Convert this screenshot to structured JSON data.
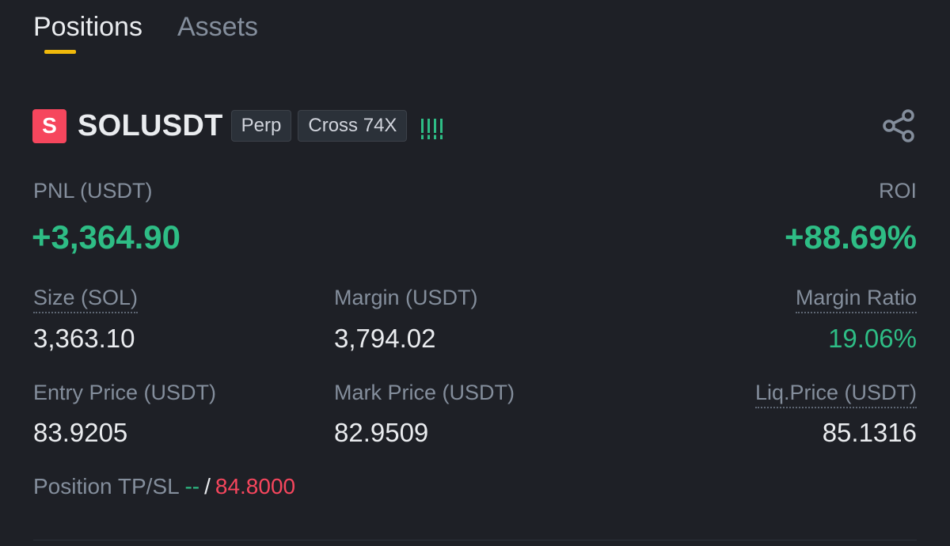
{
  "tabs": [
    "Positions",
    "Assets"
  ],
  "position": {
    "side_letter": "S",
    "symbol": "SOLUSDT",
    "type_tag": "Perp",
    "margin_tag": "Cross 74X",
    "pnl_label": "PNL (USDT)",
    "pnl_value": "+3,364.90",
    "roi_label": "ROI",
    "roi_value": "+88.69%",
    "size_label": "Size (SOL)",
    "size_value": "3,363.10",
    "margin_label": "Margin (USDT)",
    "margin_value": "3,794.02",
    "margin_ratio_label": "Margin Ratio",
    "margin_ratio_value": "19.06%",
    "entry_label": "Entry Price (USDT)",
    "entry_value": "83.9205",
    "mark_label": "Mark Price (USDT)",
    "mark_value": "82.9509",
    "liq_label": "Liq.Price (USDT)",
    "liq_value": "85.1316",
    "tpsl_label": "Position TP/SL",
    "tp_value": "--",
    "tpsl_separator": "/",
    "sl_value": "84.8000"
  },
  "icons": {
    "share": "share-icon",
    "signal": "adl-indicator-icon"
  },
  "colors": {
    "background": "#1e2026",
    "accent": "#f0b90b",
    "positive": "#2ebd85",
    "negative": "#f6465d",
    "muted": "#848e9c"
  }
}
